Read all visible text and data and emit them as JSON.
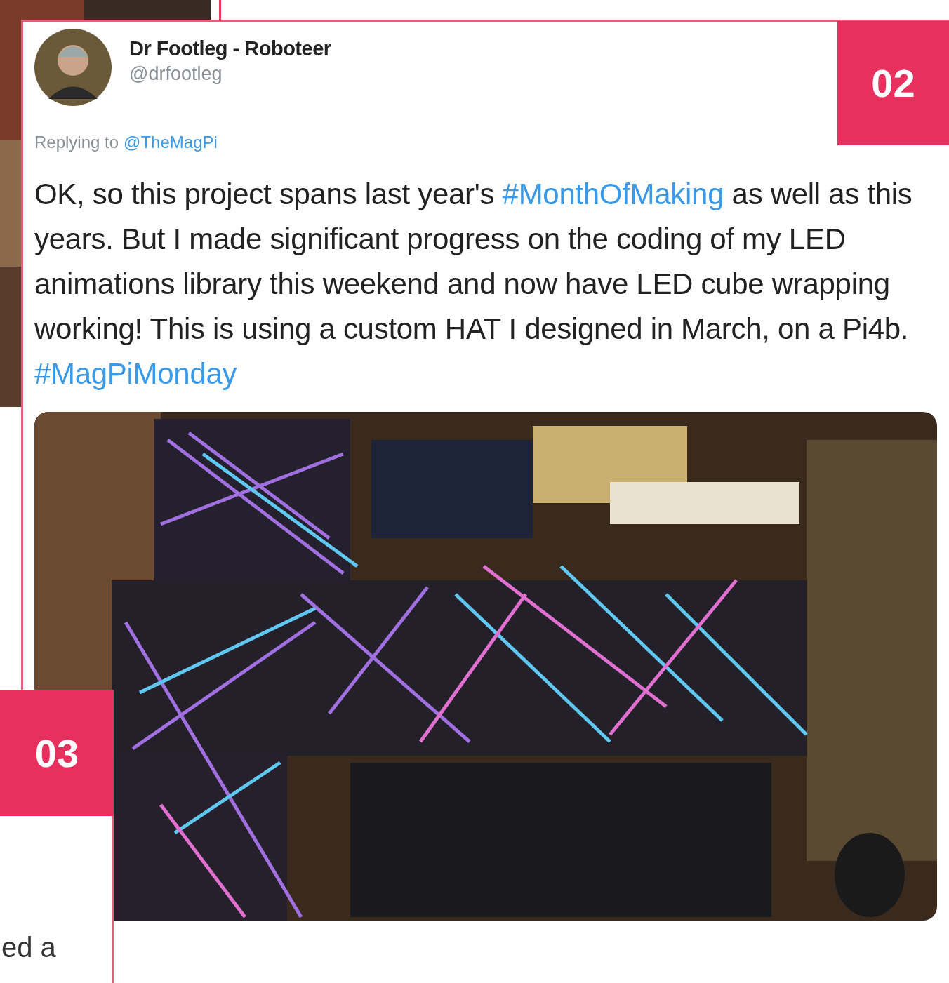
{
  "tweet": {
    "author": {
      "name": "Dr Footleg - Roboteer",
      "handle": "@drfootleg"
    },
    "replying_label": "Replying to",
    "replying_to": "@TheMagPi",
    "body": [
      {
        "kind": "text",
        "text": "OK, so this project spans last year's "
      },
      {
        "kind": "hashtag",
        "text": "#MonthOfMaking"
      },
      {
        "kind": "text",
        "text": " as well as this years. But I made significant progress on the coding of my LED animations library this weekend and now have LED cube wrapping working! This is using a custom HAT I designed in March, on a Pi4b. "
      },
      {
        "kind": "hashtag",
        "text": "#MagPiMonday"
      }
    ]
  },
  "badges": [
    {
      "text": "02"
    },
    {
      "text": "03"
    }
  ],
  "side_text": "ed a"
}
